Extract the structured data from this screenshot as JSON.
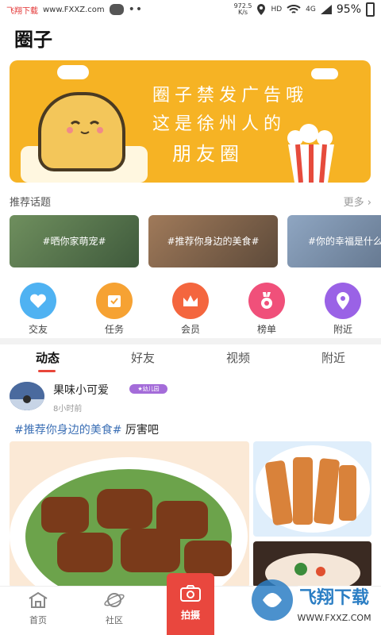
{
  "status_bar": {
    "brand": "飞翔下载",
    "url": "www.FXXZ.com",
    "speed_value": "972.5",
    "speed_unit": "K/s",
    "hd": "HD",
    "net": "4G",
    "battery": "95%"
  },
  "header": {
    "title": "圈子"
  },
  "banner": {
    "line1": "圈子禁发广告哦",
    "line2": "这是徐州人的",
    "line3": "朋友圈",
    "accent_color": "#f6b324"
  },
  "topics_section": {
    "title": "推荐话题",
    "more": "更多",
    "items": [
      {
        "label": "#晒你家萌宠#"
      },
      {
        "label": "#推荐你身边的美食#"
      },
      {
        "label": "#你的幸福是什么"
      }
    ]
  },
  "quick_menu": [
    {
      "label": "交友",
      "icon": "heart-icon",
      "color": "#4fb2f2"
    },
    {
      "label": "任务",
      "icon": "task-icon",
      "color": "#f6a233"
    },
    {
      "label": "会员",
      "icon": "crown-icon",
      "color": "#f4663e"
    },
    {
      "label": "榜单",
      "icon": "medal-icon",
      "color": "#f0507a"
    },
    {
      "label": "附近",
      "icon": "location-icon",
      "color": "#9a62e6"
    }
  ],
  "tabs": [
    {
      "label": "动态",
      "active": true
    },
    {
      "label": "好友",
      "active": false
    },
    {
      "label": "视频",
      "active": false
    },
    {
      "label": "附近",
      "active": false
    }
  ],
  "post": {
    "username": "果味小可爱",
    "badge": "幼儿园",
    "time": "8小时前",
    "hashtag": "#推荐你身边的美食#",
    "text": " 厉害吧"
  },
  "bottom_nav": [
    {
      "label": "首页",
      "icon": "home-icon"
    },
    {
      "label": "社区",
      "icon": "planet-icon"
    },
    {
      "label": "拍摄",
      "icon": "camera-icon"
    }
  ],
  "watermark": {
    "text": "飞翔下载",
    "url": "WWW.FXXZ.COM"
  }
}
